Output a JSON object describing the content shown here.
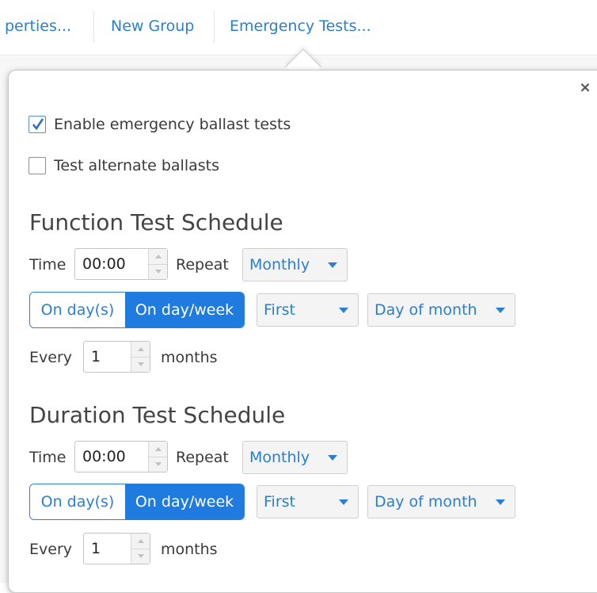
{
  "toolbar": {
    "items": [
      "perties...",
      "New Group",
      "Emergency Tests..."
    ]
  },
  "popover": {
    "close_symbol": "×",
    "enable_tests": {
      "label": "Enable emergency ballast tests",
      "checked": true
    },
    "alternate_ballasts": {
      "label": "Test alternate ballasts",
      "checked": false
    },
    "function_schedule": {
      "title": "Function Test Schedule",
      "time_label": "Time",
      "time_value": "00:00",
      "repeat_label": "Repeat",
      "repeat_value": "Monthly",
      "toggle_left": "On day(s)",
      "toggle_right": "On day/week",
      "toggle_selected": "On day/week",
      "week_select": "First",
      "day_select": "Day of month",
      "every_label": "Every",
      "every_value": "1",
      "every_unit": "months"
    },
    "duration_schedule": {
      "title": "Duration Test Schedule",
      "time_label": "Time",
      "time_value": "00:00",
      "repeat_label": "Repeat",
      "repeat_value": "Monthly",
      "toggle_left": "On day(s)",
      "toggle_right": "On day/week",
      "toggle_selected": "On day/week",
      "week_select": "First",
      "day_select": "Day of month",
      "every_label": "Every",
      "every_value": "1",
      "every_unit": "months"
    }
  },
  "colors": {
    "accent": "#2a7fd4",
    "toggle_active": "#1f7be0"
  }
}
